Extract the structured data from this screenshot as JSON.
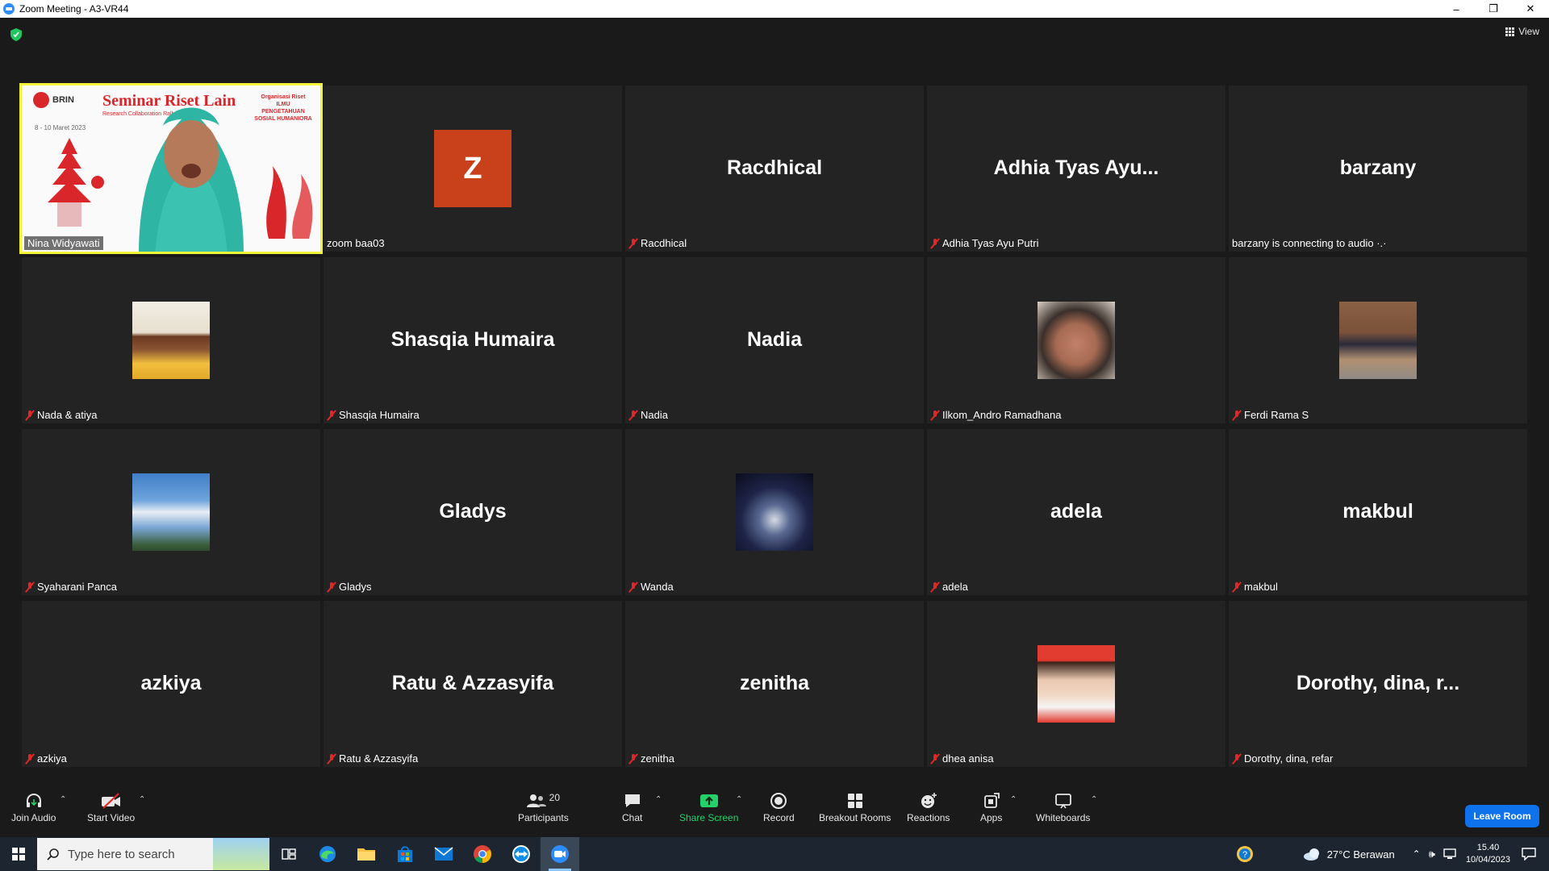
{
  "window": {
    "title": "Zoom Meeting - A3-VR44",
    "controls": [
      "–",
      "❐",
      "✕"
    ]
  },
  "meeting": {
    "view_label": "View",
    "security_icon": "shield-check-icon",
    "accent_active": "#f3f33a"
  },
  "active_speaker": {
    "name": "Nina Widyawati",
    "banner": {
      "logo_text": "BRIN",
      "title": "Seminar Riset Lain",
      "subtitle": "Research Collaboration Rally",
      "date": "8 - 10 Maret 2023",
      "right_text_1": "Organisasi Riset",
      "right_text_2": "ILMU PENGETAHUAN",
      "right_text_3": "SOSIAL HUMANIORA"
    }
  },
  "participants": [
    {
      "big": "",
      "label": "zoom baa03",
      "avatar": "z",
      "letter": "Z",
      "muted": false
    },
    {
      "big": "Racdhical",
      "label": "Racdhical",
      "avatar": "",
      "muted": true
    },
    {
      "big": "Adhia Tyas Ayu...",
      "label": "Adhia Tyas Ayu Putri",
      "avatar": "",
      "muted": true
    },
    {
      "big": "barzany",
      "label": "barzany is connecting to audio ·.·",
      "avatar": "",
      "muted": false
    },
    {
      "big": "",
      "label": "Nada & atiya",
      "avatar": "photo-girl1",
      "muted": true
    },
    {
      "big": "Shasqia Humaira",
      "label": "Shasqia Humaira",
      "avatar": "",
      "muted": true
    },
    {
      "big": "Nadia",
      "label": "Nadia",
      "avatar": "",
      "muted": true
    },
    {
      "big": "",
      "label": "Ilkom_Andro Ramadhana",
      "avatar": "photo-boy",
      "muted": true
    },
    {
      "big": "",
      "label": "Ferdi Rama S",
      "avatar": "photo-boy2",
      "muted": true
    },
    {
      "big": "",
      "label": "Syaharani Panca",
      "avatar": "photo-sky",
      "muted": true
    },
    {
      "big": "Gladys",
      "label": "Gladys",
      "avatar": "",
      "muted": true
    },
    {
      "big": "",
      "label": "Wanda",
      "avatar": "photo-guitar",
      "muted": true
    },
    {
      "big": "adela",
      "label": "adela",
      "avatar": "",
      "muted": true
    },
    {
      "big": "makbul",
      "label": "makbul",
      "avatar": "",
      "muted": true
    },
    {
      "big": "azkiya",
      "label": "azkiya",
      "avatar": "",
      "muted": true
    },
    {
      "big": "Ratu & Azzasyifa",
      "label": "Ratu & Azzasyifa",
      "avatar": "",
      "muted": true
    },
    {
      "big": "zenitha",
      "label": "zenitha",
      "avatar": "",
      "muted": true
    },
    {
      "big": "",
      "label": "dhea anisa",
      "avatar": "photo-girl2",
      "muted": true
    },
    {
      "big": "Dorothy, dina, r...",
      "label": "Dorothy, dina, refar",
      "avatar": "",
      "muted": true
    }
  ],
  "toolbar": {
    "join_audio": "Join Audio",
    "start_video": "Start Video",
    "participants_count": "20",
    "participants": "Participants",
    "chat": "Chat",
    "share_screen": "Share Screen",
    "record": "Record",
    "breakout_rooms": "Breakout Rooms",
    "reactions": "Reactions",
    "apps": "Apps",
    "whiteboards": "Whiteboards",
    "leave_room": "Leave Room",
    "share_color": "#25d06b",
    "leave_color": "#0e72ed"
  },
  "taskbar": {
    "search_placeholder": "Type here to search",
    "weather": "27°C  Berawan",
    "time": "15.40",
    "date": "10/04/2023"
  }
}
